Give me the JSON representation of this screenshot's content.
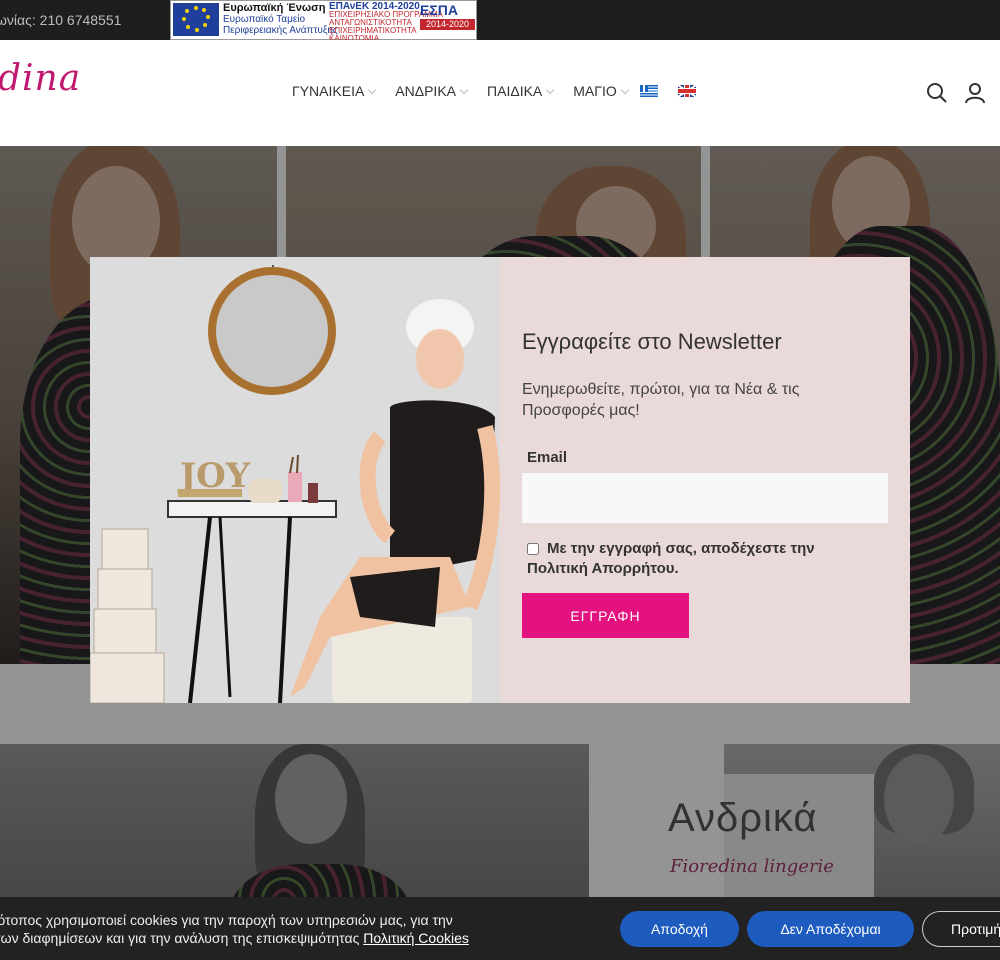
{
  "topbar": {
    "phone_text": "ωνίας: 210 6748551"
  },
  "espa_banner": {
    "eu_title": "Ευρωπαϊκή Ένωση",
    "eu_line1": "Ευρωπαϊκό Ταμείο",
    "eu_line2": "Περιφερειακής Ανάπτυξης",
    "epanek_title": "ΕΠΑνΕΚ 2014-2020",
    "epanek_line1": "ΕΠΙΧΕΙΡΗΣΙΑΚΟ ΠΡΟΓΡΑΜΜΑ",
    "epanek_line2": "ΑΝΤΑΓΩΝΙΣΤΙΚΟΤΗΤΑ",
    "epanek_line3": "ΕΠΙΧΕΙΡΗΜΑΤΙΚΟΤΗΤΑ",
    "epanek_line4": "ΚΑΙΝΟΤΟΜΙΑ",
    "espa_title": "ΕΣΠΑ",
    "espa_years": "2014-2020"
  },
  "header": {
    "logo_text": "dina",
    "nav": [
      {
        "label": "ΓΥΝΑΙΚΕΙΑ"
      },
      {
        "label": "ΑΝΔΡΙΚΑ"
      },
      {
        "label": "ΠΑΙΔΙΚΑ"
      },
      {
        "label": "ΜΑΓΙΟ"
      }
    ],
    "icons": [
      "greek-flag-icon",
      "uk-flag-icon",
      "search-icon",
      "user-icon"
    ]
  },
  "popup": {
    "title": "Εγγραφείτε στο Newsletter",
    "subtitle": "Ενημερωθείτε, πρώτοι, για τα Νέα & τις Προσφορές μας!",
    "email_label": "Email",
    "email_value": "",
    "consent_text": "Με την εγγραφή σας, αποδέχεστε την Πολιτική Απορρήτου.",
    "submit_label": "ΕΓΓΡΑΦΗ",
    "image_text": "JOY"
  },
  "lower": {
    "andrika_title": "Ανδρικά",
    "andrika_sub": "Fioredina lingerie"
  },
  "cookie": {
    "text_line1": "τότοπος χρησιμοποιεί cookies για την παροχή των υπηρεσιών μας, για την",
    "text_line2": "σων διαφημίσεων και για την ανάλυση της επισκεψιμότητας",
    "link_text": "Πολιτική Cookies",
    "accept_label": "Αποδοχή",
    "decline_label": "Δεν Αποδέχομαι",
    "prefs_label": "Προτιμήσεις"
  },
  "colors": {
    "accent": "#e3127f",
    "popup_bg": "#ead9d9",
    "cookie_button": "#1d5bbf",
    "logo": "#c0186e"
  }
}
